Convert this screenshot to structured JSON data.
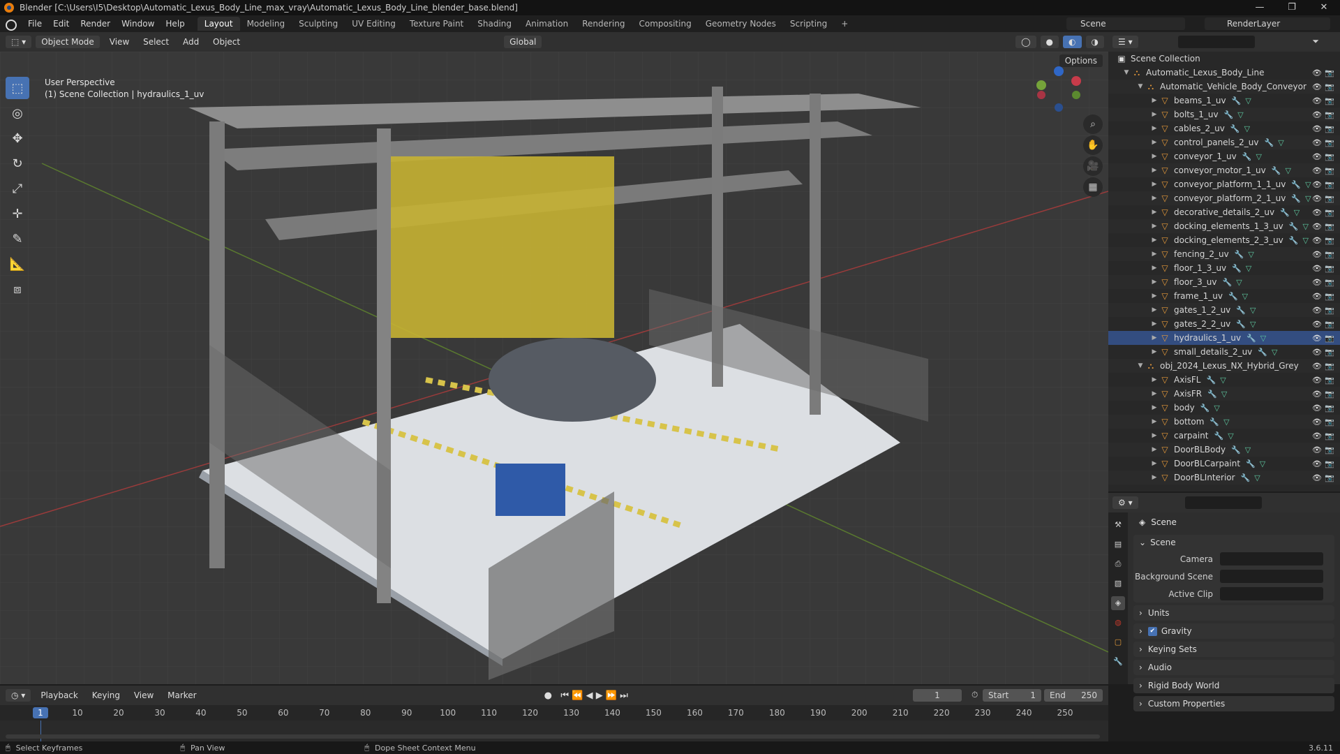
{
  "window": {
    "title": "Blender [C:\\Users\\I5\\Desktop\\Automatic_Lexus_Body_Line_max_vray\\Automatic_Lexus_Body_Line_blender_base.blend]",
    "min": "—",
    "max": "❐",
    "close": "✕"
  },
  "menu": [
    "File",
    "Edit",
    "Render",
    "Window",
    "Help"
  ],
  "workspaces": [
    "Layout",
    "Modeling",
    "Sculpting",
    "UV Editing",
    "Texture Paint",
    "Shading",
    "Animation",
    "Rendering",
    "Compositing",
    "Geometry Nodes",
    "Scripting",
    "+"
  ],
  "scene_name": "Scene",
  "render_layer": "RenderLayer",
  "viewport_header": {
    "mode": "Object Mode",
    "menus": [
      "View",
      "Select",
      "Add",
      "Object"
    ],
    "orientation": "Global",
    "options": "Options"
  },
  "viewport": {
    "perspective": "User Perspective",
    "collection_info": "(1) Scene Collection | hydraulics_1_uv"
  },
  "outliner": {
    "root": "Scene Collection",
    "rows": [
      {
        "name": "Automatic_Lexus_Body_Line",
        "level": 1,
        "type": "collection",
        "expanded": true
      },
      {
        "name": "Automatic_Vehicle_Body_Conveyor",
        "level": 2,
        "type": "collection",
        "expanded": true
      },
      {
        "name": "beams_1_uv",
        "level": 3,
        "type": "mesh"
      },
      {
        "name": "bolts_1_uv",
        "level": 3,
        "type": "mesh"
      },
      {
        "name": "cables_2_uv",
        "level": 3,
        "type": "mesh"
      },
      {
        "name": "control_panels_2_uv",
        "level": 3,
        "type": "mesh"
      },
      {
        "name": "conveyor_1_uv",
        "level": 3,
        "type": "mesh"
      },
      {
        "name": "conveyor_motor_1_uv",
        "level": 3,
        "type": "mesh"
      },
      {
        "name": "conveyor_platform_1_1_uv",
        "level": 3,
        "type": "mesh"
      },
      {
        "name": "conveyor_platform_2_1_uv",
        "level": 3,
        "type": "mesh"
      },
      {
        "name": "decorative_details_2_uv",
        "level": 3,
        "type": "mesh"
      },
      {
        "name": "docking_elements_1_3_uv",
        "level": 3,
        "type": "mesh"
      },
      {
        "name": "docking_elements_2_3_uv",
        "level": 3,
        "type": "mesh"
      },
      {
        "name": "fencing_2_uv",
        "level": 3,
        "type": "mesh"
      },
      {
        "name": "floor_1_3_uv",
        "level": 3,
        "type": "mesh"
      },
      {
        "name": "floor_3_uv",
        "level": 3,
        "type": "mesh"
      },
      {
        "name": "frame_1_uv",
        "level": 3,
        "type": "mesh"
      },
      {
        "name": "gates_1_2_uv",
        "level": 3,
        "type": "mesh"
      },
      {
        "name": "gates_2_2_uv",
        "level": 3,
        "type": "mesh"
      },
      {
        "name": "hydraulics_1_uv",
        "level": 3,
        "type": "mesh",
        "selected": true
      },
      {
        "name": "small_details_2_uv",
        "level": 3,
        "type": "mesh"
      },
      {
        "name": "obj_2024_Lexus_NX_Hybrid_Grey",
        "level": 2,
        "type": "collection",
        "expanded": true
      },
      {
        "name": "AxisFL",
        "level": 3,
        "type": "mesh"
      },
      {
        "name": "AxisFR",
        "level": 3,
        "type": "mesh"
      },
      {
        "name": "body",
        "level": 3,
        "type": "mesh"
      },
      {
        "name": "bottom",
        "level": 3,
        "type": "mesh"
      },
      {
        "name": "carpaint",
        "level": 3,
        "type": "mesh"
      },
      {
        "name": "DoorBLBody",
        "level": 3,
        "type": "mesh"
      },
      {
        "name": "DoorBLCarpaint",
        "level": 3,
        "type": "mesh"
      },
      {
        "name": "DoorBLInterior",
        "level": 3,
        "type": "mesh"
      }
    ]
  },
  "properties": {
    "title": "Scene",
    "panel_scene": "Scene",
    "camera_label": "Camera",
    "bg_scene_label": "Background Scene",
    "active_clip_label": "Active Clip",
    "sections": [
      "Units",
      "Gravity",
      "Keying Sets",
      "Audio",
      "Rigid Body World",
      "Custom Properties"
    ]
  },
  "timeline": {
    "menus": [
      "Playback",
      "Keying",
      "View",
      "Marker"
    ],
    "current_frame": "1",
    "start_label": "Start",
    "start": "1",
    "end_label": "End",
    "end": "250",
    "ticks": [
      1,
      10,
      20,
      30,
      40,
      50,
      60,
      70,
      80,
      90,
      100,
      110,
      120,
      130,
      140,
      150,
      160,
      170,
      180,
      190,
      200,
      210,
      220,
      230,
      240,
      250
    ]
  },
  "status": {
    "left": "Select Keyframes",
    "middle": "Pan View",
    "right": "Dope Sheet Context Menu",
    "version": "3.6.11"
  }
}
